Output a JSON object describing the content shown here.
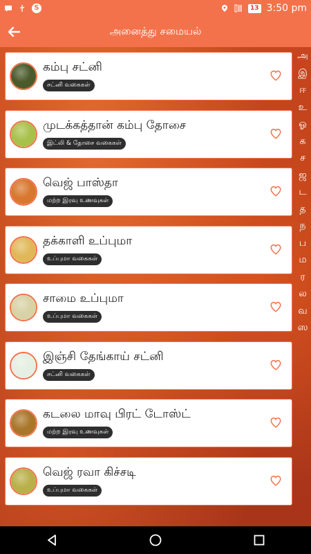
{
  "status_bar": {
    "time": "3:50 pm",
    "battery": "13",
    "icons": [
      "sms-icon",
      "usb-icon",
      "skype-icon",
      "location-icon",
      "signal-icon",
      "battery-icon"
    ]
  },
  "app_bar": {
    "title": "அனைத்து சமையல்",
    "back_icon": "arrow-left-icon"
  },
  "recipes": [
    {
      "title": "கம்பு சட்னி",
      "tag": "சட்னி வகைகள்",
      "thumb_color": "#4a5a2a"
    },
    {
      "title": "முடக்கத்தான் கம்பு தோசை",
      "tag": "இட்லி & தோசை வகைகள்",
      "thumb_color": "#a8c14a"
    },
    {
      "title": "வெஜ் பாஸ்தா",
      "tag": "மற்ற இரவு உணவுகள்",
      "thumb_color": "#d8772e"
    },
    {
      "title": "தக்காளி உப்புமா",
      "tag": "உப்புமா வகைகள்",
      "thumb_color": "#e0b85a"
    },
    {
      "title": "சாமை உப்புமா",
      "tag": "உப்புமா வகைகள்",
      "thumb_color": "#d8d2a6"
    },
    {
      "title": "இஞ்சி தேங்காய் சட்னி",
      "tag": "சட்னி வகைகள்",
      "thumb_color": "#e6efe3"
    },
    {
      "title": "கடலை மாவு பிரட் டோஸ்ட்",
      "tag": "மற்ற இரவு உணவுகள்",
      "thumb_color": "#a9762a"
    },
    {
      "title": "வெஜ் ரவா கிச்சடி",
      "tag": "உப்புமா வகைகள்",
      "thumb_color": "#b9b04a"
    }
  ],
  "alphabet_index": [
    "அ",
    "இ",
    "ஈ",
    "உ",
    "ஓ",
    "க",
    "ச",
    "ஜ",
    "ட",
    "த",
    "ந",
    "ப",
    "ம",
    "ர",
    "ல",
    "வ",
    "ஸ"
  ],
  "accent_color": "#f4724b"
}
